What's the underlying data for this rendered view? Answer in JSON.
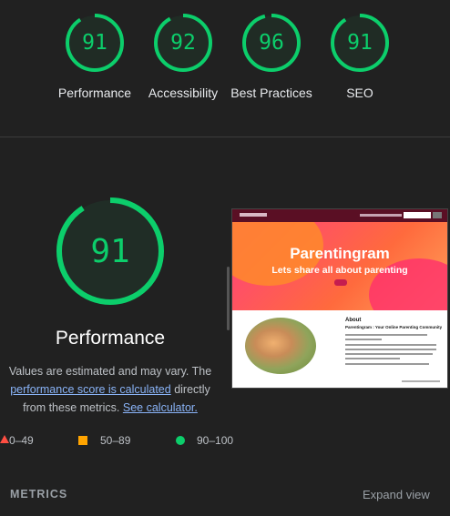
{
  "scores": [
    {
      "value": "91",
      "label": "Performance"
    },
    {
      "value": "92",
      "label": "Accessibility"
    },
    {
      "value": "96",
      "label": "Best Practices"
    },
    {
      "value": "91",
      "label": "SEO"
    }
  ],
  "main": {
    "score": "91",
    "title": "Performance",
    "desc_prefix": "Values are estimated and may vary. The",
    "desc_link": "performance score is calculated",
    "desc_middle": "directly from these metrics.",
    "calc_link": "See calculator."
  },
  "screenshot": {
    "hero_title": "Parentingram",
    "hero_subtitle": "Lets share all about parenting",
    "about_heading": "About",
    "about_subheading": "Parentingram : Your Online Parenting Community"
  },
  "legend": [
    {
      "range": "0–49",
      "color": "#ff4e42",
      "shape": "triangle"
    },
    {
      "range": "50–89",
      "color": "#ffa400",
      "shape": "square"
    },
    {
      "range": "90–100",
      "color": "#0cce6b",
      "shape": "circle"
    }
  ],
  "metrics": {
    "label": "METRICS",
    "expand": "Expand view"
  },
  "colors": {
    "pass": "#0cce6b",
    "background": "#212121",
    "link": "#8ab4f8"
  }
}
